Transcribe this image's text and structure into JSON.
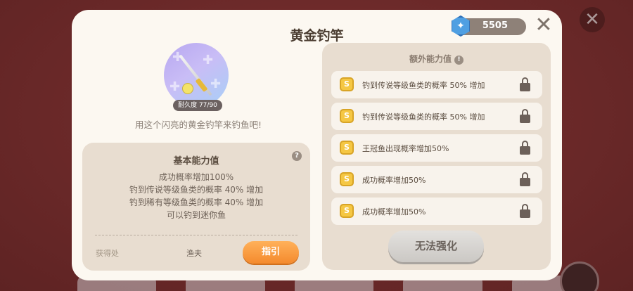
{
  "modal": {
    "title": "黄金钓竿",
    "currency": {
      "icon": "diamond-gem-icon",
      "value": "5505"
    },
    "close_label": "✕"
  },
  "item": {
    "icon": "golden-fishing-rod-icon",
    "durability": "耐久度 77/90",
    "durability_fraction": 0.856,
    "description": "用这个闪亮的黄金钓竿来钓鱼吧!"
  },
  "basic": {
    "title": "基本能力值",
    "lines": [
      "成功概率增加100%",
      "钓到传说等级鱼类的概率 40% 增加",
      "钓到稀有等级鱼类的概率 40% 增加",
      "可以钓到迷你鱼"
    ],
    "source_label": "获得处",
    "source_value": "渔夫",
    "guide_button": "指引"
  },
  "extra": {
    "title": "额外能力值",
    "rows": [
      {
        "badge": "S",
        "text": "钓到传说等级鱼类的概率 50% 增加",
        "locked": true
      },
      {
        "badge": "S",
        "text": "钓到传说等级鱼类的概率 50% 增加",
        "locked": true
      },
      {
        "badge": "S",
        "text": "王冠鱼出现概率增加50%",
        "locked": true
      },
      {
        "badge": "S",
        "text": "成功概率增加50%",
        "locked": true
      },
      {
        "badge": "S",
        "text": "成功概率增加50%",
        "locked": true
      }
    ],
    "enhance_button": "无法强化"
  },
  "colors": {
    "accent_orange": "#f48a2d",
    "panel_bg": "#e8ddd0",
    "modal_bg": "#fcf8f1",
    "coin_gold": "#f5c743"
  }
}
